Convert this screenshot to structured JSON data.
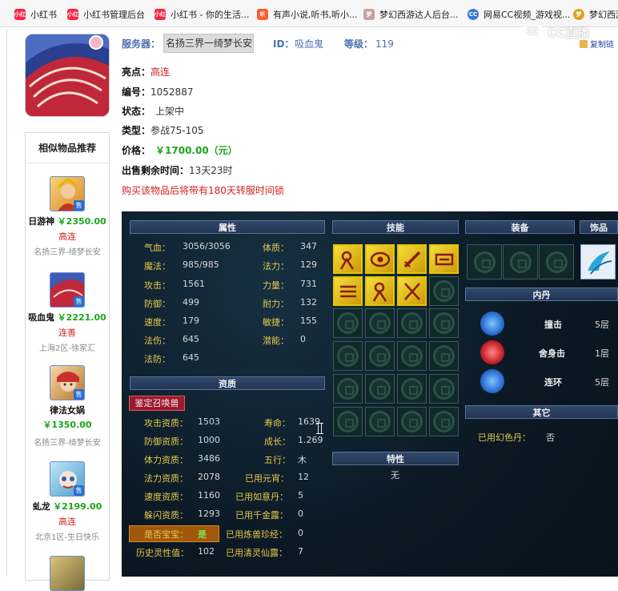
{
  "bookmarks": [
    {
      "label": "小红书",
      "icon": "xiaohongshu-icon",
      "color": "#ff2442"
    },
    {
      "label": "小红书管理后台",
      "icon": "xiaohongshu-icon",
      "color": "#ff2442"
    },
    {
      "label": "小红书 - 你的生活...",
      "icon": "xiaohongshu-icon",
      "color": "#ff2442"
    },
    {
      "label": "有声小说,听书,听小...",
      "icon": "audiobook-icon",
      "color": "#ff5a2a"
    },
    {
      "label": "梦幻西游达人后台...",
      "icon": "mhxy-icon",
      "color": "#c9a0a0"
    },
    {
      "label": "网易CC视频_游戏视...",
      "icon": "netease-cc-icon",
      "color": "#3a7bd5"
    },
    {
      "label": "梦幻西游",
      "icon": "mhxy-icon",
      "color": "#e0a020"
    }
  ],
  "watermark": "CC直播",
  "header": {
    "server_label": "服务器：",
    "server_value": "名扬三界一绮梦长安",
    "id_label": "ID：",
    "id_value": "吸血鬼",
    "level_label": "等级：",
    "level_value": "119",
    "copy_label": "复制链"
  },
  "info": {
    "highlight_label": "亮点：",
    "highlight_value": "高连",
    "number_label": "编号：",
    "number_value": "1052887",
    "status_label": "状态：",
    "status_value": "上架中",
    "type_label": "类型：",
    "type_value": "参战75-105",
    "price_label": "价格：",
    "price_value": "￥1700.00（元）",
    "time_label": "出售剩余时间：",
    "time_value": "13天23时",
    "notice": "购买该物品后将带有180天转服时间锁"
  },
  "similar": {
    "title": "相似物品推荐",
    "sell_badge": "售",
    "items": [
      {
        "name": "日游神",
        "price": "￥2350.00",
        "tag": "高连",
        "server": "名扬三界-绮梦长安"
      },
      {
        "name": "吸血鬼",
        "price": "￥2221.00",
        "tag": "连善",
        "server": "上海2区-徐家汇"
      },
      {
        "name": "律法女娲",
        "price": "￥1350.00",
        "tag": "",
        "server": "名扬三界-绮梦长安"
      },
      {
        "name": "虬龙",
        "price": "￥2199.00",
        "tag": "高连",
        "server": "北京1区-生日快乐"
      }
    ]
  },
  "panel": {
    "attributes_header": "属性",
    "attributes": [
      {
        "label": "气血：",
        "value": "3056/3056"
      },
      {
        "label": "魔法：",
        "value": "985/985"
      },
      {
        "label": "攻击：",
        "value": "1561"
      },
      {
        "label": "防御：",
        "value": "499"
      },
      {
        "label": "速度：",
        "value": "179"
      },
      {
        "label": "法伤：",
        "value": "645"
      },
      {
        "label": "法防：",
        "value": "645"
      }
    ],
    "attributes_right": [
      {
        "label": "体质：",
        "value": "347"
      },
      {
        "label": "法力：",
        "value": "129"
      },
      {
        "label": "力量：",
        "value": "731"
      },
      {
        "label": "耐力：",
        "value": "132"
      },
      {
        "label": "敏捷：",
        "value": "155"
      },
      {
        "label": "潜能：",
        "value": "0"
      }
    ],
    "aptitude_header": "资质",
    "appraise_button": "鉴定召唤兽",
    "aptitude_left": [
      {
        "label": "攻击资质：",
        "value": "1503"
      },
      {
        "label": "防御资质：",
        "value": "1000"
      },
      {
        "label": "体力资质：",
        "value": "3486"
      },
      {
        "label": "法力资质：",
        "value": "2078"
      },
      {
        "label": "速度资质：",
        "value": "1160"
      },
      {
        "label": "躲闪资质：",
        "value": "1293"
      },
      {
        "label": "是否宝宝：",
        "value": "是"
      },
      {
        "label": "历史灵性值：",
        "value": "102"
      }
    ],
    "aptitude_right": [
      {
        "label": "寿命：",
        "value": "1639"
      },
      {
        "label": "成长：",
        "value": "1.269"
      },
      {
        "label": "五行：",
        "value": "木"
      },
      {
        "label": "已用元宵：",
        "value": "12"
      },
      {
        "label": "已用如意丹：",
        "value": "5"
      },
      {
        "label": "已用千金露：",
        "value": "0"
      },
      {
        "label": "已用炼兽珍经：",
        "value": "0"
      },
      {
        "label": "已用清灵仙露：",
        "value": "7"
      }
    ],
    "skills_header": "技能",
    "trait_header": "特性",
    "trait_value": "无",
    "equipment_header": "装备",
    "ornament_header": "饰品",
    "inner_header": "内丹",
    "inner": [
      {
        "name": "撞击",
        "level": "5层",
        "color": "#2b6fd1"
      },
      {
        "name": "舍身击",
        "level": "1层",
        "color": "#c8202a"
      },
      {
        "name": "连环",
        "level": "5层",
        "color": "#2b6fd1"
      }
    ],
    "other_header": "其它",
    "other_label": "已用幻色丹：",
    "other_value": "否"
  }
}
